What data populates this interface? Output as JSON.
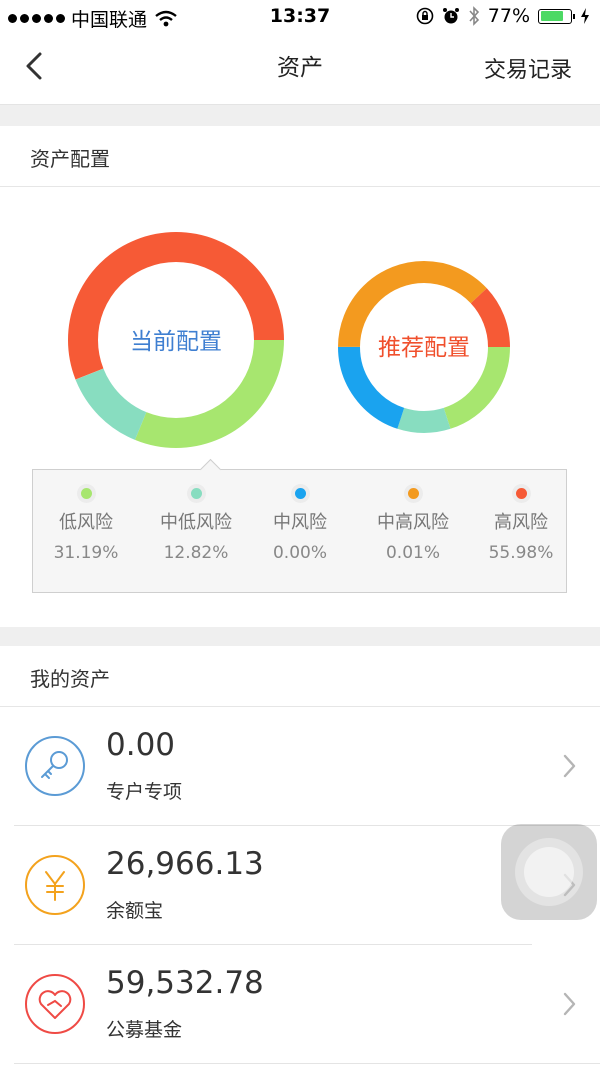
{
  "status_bar": {
    "carrier": "中国联通",
    "time": "13:37",
    "battery": "77%",
    "battery_level": 0.77
  },
  "nav": {
    "title": "资产",
    "action_label": "交易记录"
  },
  "allocation": {
    "section_title": "资产配置",
    "current_label": "当前配置",
    "recommended_label": "推荐配置",
    "legend": [
      {
        "name": "低风险",
        "percent": "31.19%",
        "color": "#a7e66f"
      },
      {
        "name": "中低风险",
        "percent": "12.82%",
        "color": "#88ddc0"
      },
      {
        "name": "中风险",
        "percent": "0.00%",
        "color": "#1aa3ef"
      },
      {
        "name": "中高风险",
        "percent": "0.01%",
        "color": "#f39a1f"
      },
      {
        "name": "高风险",
        "percent": "55.98%",
        "color": "#f65a36"
      }
    ]
  },
  "chart_data": [
    {
      "type": "pie",
      "title": "当前配置",
      "categories": [
        "低风险",
        "中低风险",
        "中风险",
        "中高风险",
        "高风险"
      ],
      "values": [
        31.19,
        12.82,
        0.0,
        0.01,
        55.98
      ],
      "colors": [
        "#a7e66f",
        "#88ddc0",
        "#1aa3ef",
        "#f39a1f",
        "#f65a36"
      ]
    },
    {
      "type": "pie",
      "title": "推荐配置",
      "categories": [
        "低风险",
        "中低风险",
        "中风险",
        "中高风险",
        "高风险"
      ],
      "values": [
        20,
        10,
        20,
        38,
        12
      ],
      "colors": [
        "#a7e66f",
        "#88ddc0",
        "#1aa3ef",
        "#f39a1f",
        "#f65a36"
      ]
    }
  ],
  "assets": {
    "section_title": "我的资产",
    "items": [
      {
        "amount": "0.00",
        "name": "专户专项",
        "icon": "key-icon",
        "color": "#5b9bd5"
      },
      {
        "amount": "26,966.13",
        "name": "余额宝",
        "icon": "yuan-icon",
        "color": "#f3a21d"
      },
      {
        "amount": "59,532.78",
        "name": "公募基金",
        "icon": "heart-icon",
        "color": "#ef4a45"
      }
    ]
  }
}
